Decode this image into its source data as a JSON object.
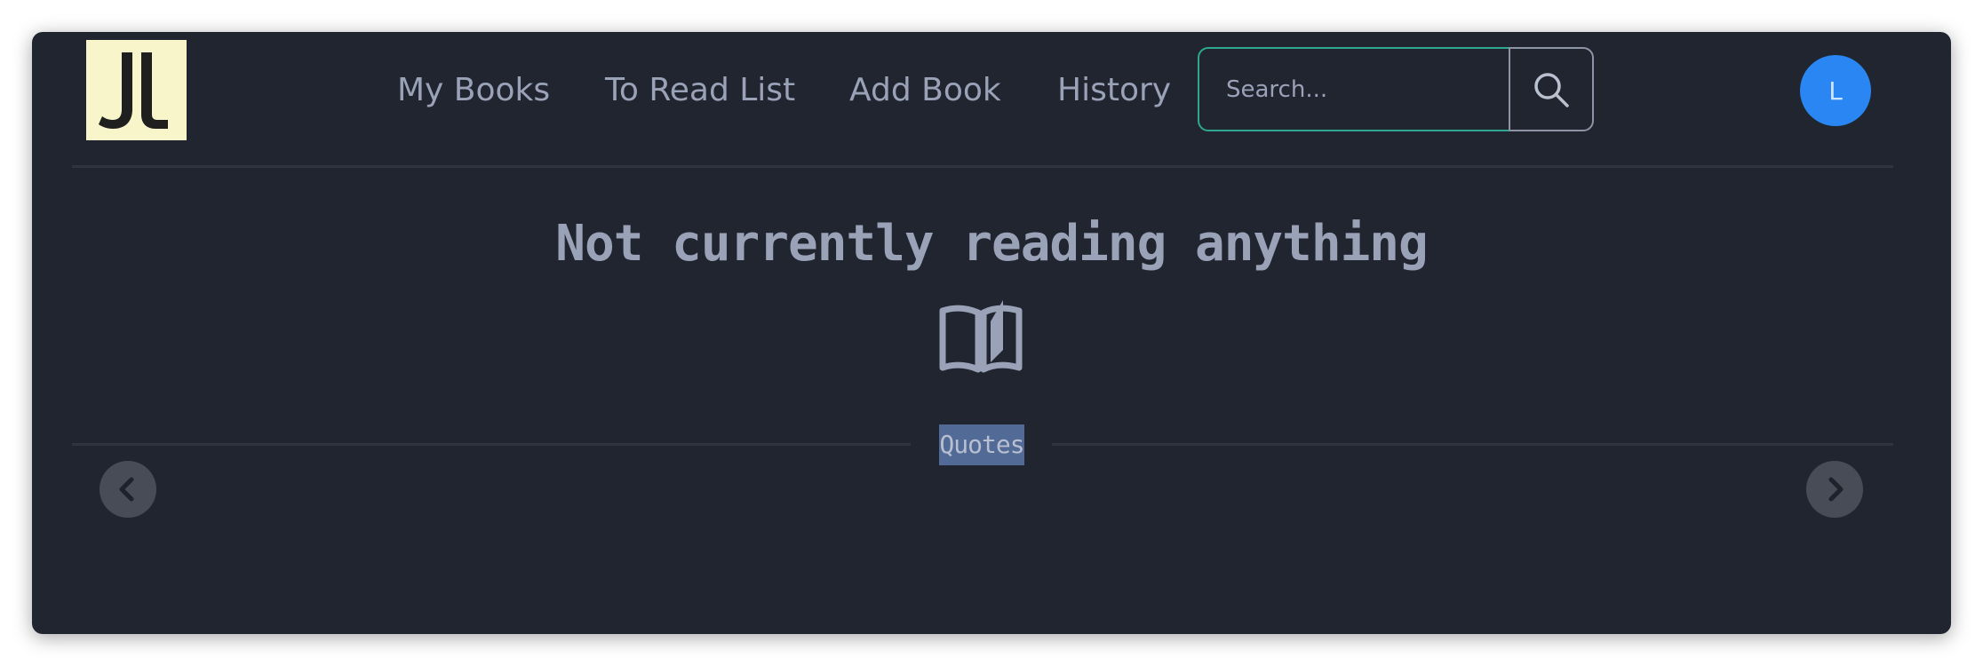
{
  "logo": {
    "icon": "jl-monogram-logo",
    "background": "#f7f5c9",
    "mark_color": "#1f1f1f"
  },
  "nav": {
    "items": [
      {
        "label": "My Books"
      },
      {
        "label": "To Read List"
      },
      {
        "label": "Add Book"
      },
      {
        "label": "History"
      }
    ]
  },
  "search": {
    "placeholder": "Search...",
    "value": "",
    "button_icon": "search-icon",
    "accent": "#2fa891"
  },
  "user": {
    "avatar_initial": "L",
    "avatar_color": "#2a86f2"
  },
  "main": {
    "headline": "Not currently reading anything",
    "icon": "open-book-icon"
  },
  "quotes": {
    "label": "Quotes",
    "prev_icon": "chevron-left-icon",
    "next_icon": "chevron-right-icon"
  },
  "theme": {
    "background": "#21252f",
    "text": "#9aa2b8"
  }
}
